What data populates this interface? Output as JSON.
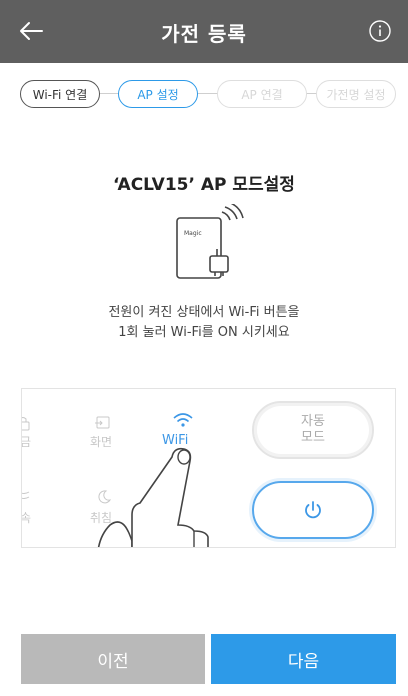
{
  "header": {
    "title": "가전 등록",
    "back_icon": "arrow-left-icon",
    "info_icon": "info-circle-icon"
  },
  "steps": [
    {
      "label": "Wi-Fi 연결",
      "state": "done"
    },
    {
      "label": "AP 설정",
      "state": "active"
    },
    {
      "label": "AP 연결",
      "state": "todo"
    },
    {
      "label": "가전명 설정",
      "state": "todo"
    }
  ],
  "main": {
    "title": "‘ACLV15’ AP 모드설정",
    "device_brand": "Magic",
    "desc_line1": "전원이 켜진 상태에서 Wi-Fi 버튼을",
    "desc_line2": "1회 눌러 Wi-Fi를  ON 시키세요"
  },
  "panel": {
    "left_top_label": "금",
    "screen_label": "화면",
    "wifi_label": "WiFi",
    "left_bottom_label": "속",
    "sleep_label": "취침",
    "auto_label_line1": "자동",
    "auto_label_line2": "모드"
  },
  "footer": {
    "prev_label": "이전",
    "next_label": "다음"
  },
  "colors": {
    "header_bg": "#5f5f5f",
    "accent": "#2d9ae8",
    "prev_bg": "#b9b9b9"
  }
}
